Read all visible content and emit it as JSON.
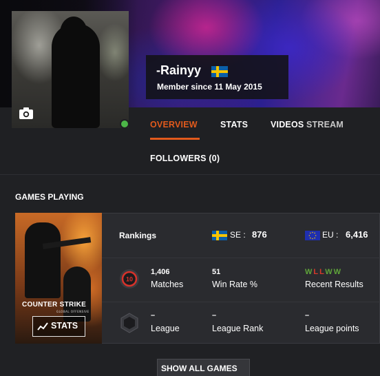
{
  "profile": {
    "name": "-Rainyy",
    "member_since": "Member since 11 May 2015",
    "flag_icon": "flag-sweden-icon",
    "online_color": "#4cb648"
  },
  "tabs": [
    {
      "label": "OVERVIEW",
      "active": true
    },
    {
      "label": "STATS"
    },
    {
      "label": "VIDEOS"
    },
    {
      "label": "STREAM"
    },
    {
      "label": "FOLLOWERS (0)"
    }
  ],
  "accent_color": "#e25a1c",
  "games_section": {
    "title": "GAMES PLAYING",
    "game": {
      "logo_text": "COUNTER STRIKE",
      "logo_sub": "GLOBAL OFFENSIVE",
      "stats_button": "STATS",
      "rankings_label": "Rankings",
      "se": {
        "label": "SE :",
        "value": "876"
      },
      "eu": {
        "label": "EU :",
        "value": "6,416"
      },
      "matches": {
        "value": "1,406",
        "label": "Matches"
      },
      "win_rate": {
        "value": "51",
        "label": "Win Rate %"
      },
      "recent_results": {
        "label": "Recent Results",
        "results": [
          "W",
          "L",
          "L",
          "W",
          "W"
        ]
      },
      "level_badge": "10",
      "league": {
        "value": "–",
        "label": "League"
      },
      "league_rank": {
        "value": "–",
        "label": "League Rank"
      },
      "league_points": {
        "value": "–",
        "label": "League points"
      }
    },
    "show_all": "SHOW ALL GAMES"
  }
}
